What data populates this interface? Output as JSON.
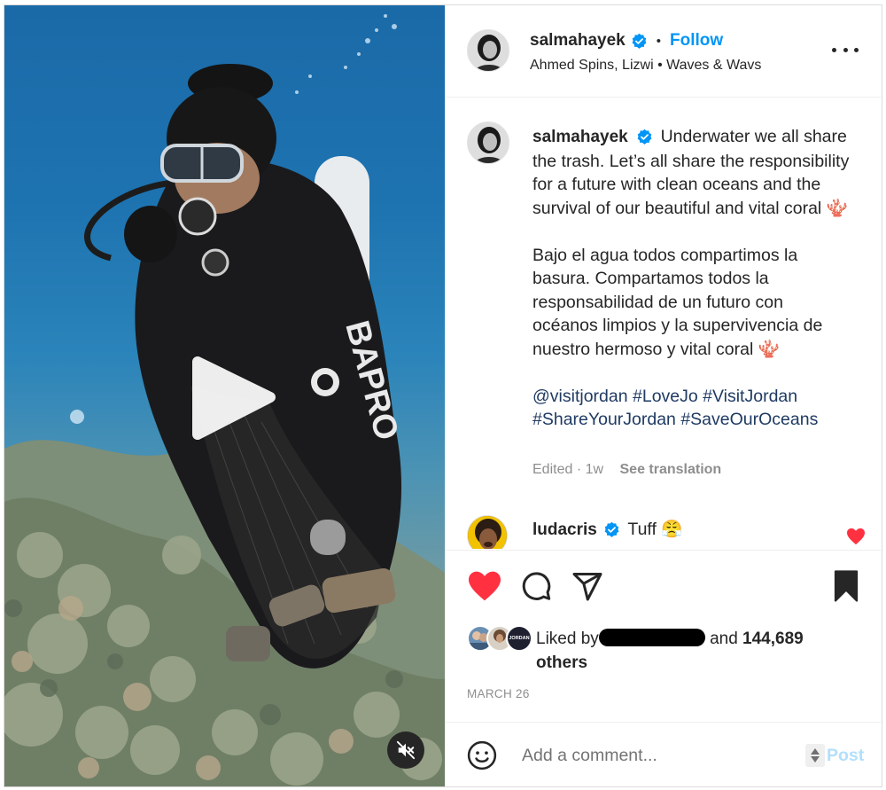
{
  "colors": {
    "accent": "#0095f6",
    "like_red": "#ff3040",
    "text": "#262626",
    "muted": "#8e8e8e",
    "hashtag": "#1f3a63",
    "post_disabled": "#b2dffc"
  },
  "media": {
    "play_icon": "play-icon",
    "mute_icon": "speaker-muted-icon"
  },
  "header": {
    "username": "salmahayek",
    "verified": true,
    "separator": "•",
    "follow_label": "Follow",
    "audio": "Ahmed Spins, Lizwi • Waves & Wavs",
    "more_icon": "more-options-icon"
  },
  "caption": {
    "username": "salmahayek",
    "text_en": "Underwater we all share the trash. Let’s all share the responsibility for a future with clean oceans and the survival of our beautiful and vital coral 🪸",
    "text_es": "Bajo el agua todos compartimos la basura. Compartamos todos la responsabilidad de un futuro con océanos limpios y la supervivencia de nuestro hermoso y vital coral 🪸",
    "hashtags": "@visitjordan #LoveJo #VisitJordan #ShareYourJordan #SaveOurOceans",
    "edited": "Edited · 1w",
    "see_translation": "See translation"
  },
  "comment": {
    "username": "ludacris",
    "verified": true,
    "text": "Tuff 😤",
    "liked": true
  },
  "actions": {
    "like_icon": "heart-filled-icon",
    "comment_icon": "comment-icon",
    "share_icon": "share-icon",
    "save_icon": "bookmark-filled-icon",
    "liked": true,
    "saved": true
  },
  "likes": {
    "prefix": "Liked by",
    "and": "and",
    "count": "144,689",
    "others": "others",
    "avatar_badge": "JORDAN"
  },
  "date": "MARCH 26",
  "add_comment": {
    "placeholder": "Add a comment...",
    "post_label": "Post",
    "emoji_icon": "emoji-icon"
  }
}
